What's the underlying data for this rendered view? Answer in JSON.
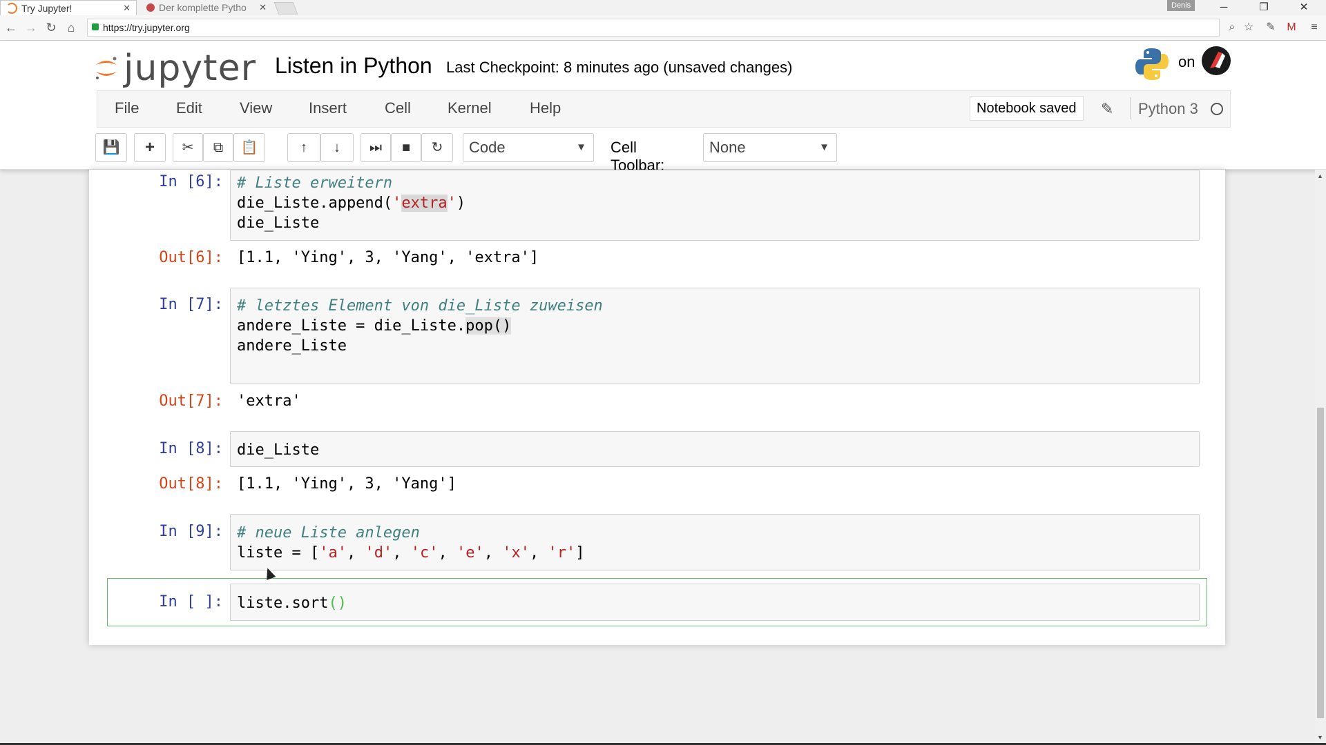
{
  "browser": {
    "tabs": [
      {
        "title": "Try Jupyter!",
        "active": true
      },
      {
        "title": "Der komplette Pytho",
        "active": false
      }
    ],
    "profile": "Denis",
    "url": "https://try.jupyter.org",
    "window_controls": [
      "minimize",
      "restore",
      "close"
    ]
  },
  "header": {
    "logo_text": "jupyter",
    "notebook_title": "Listen in Python",
    "checkpoint": "Last Checkpoint: 8 minutes ago (unsaved changes)",
    "on_text": "on"
  },
  "menu": {
    "items": [
      "File",
      "Edit",
      "View",
      "Insert",
      "Cell",
      "Kernel",
      "Help"
    ],
    "status": "Notebook saved",
    "kernel": "Python 3"
  },
  "toolbar": {
    "cell_type": "Code",
    "cell_toolbar_label": "Cell Toolbar:",
    "cell_toolbar_value": "None"
  },
  "cells": [
    {
      "in_prompt": "In [6]:",
      "code": {
        "l1_comment": "# Liste erweitern",
        "l2_pre": "die_Liste.append(",
        "l2_str_q1": "'",
        "l2_str_body": "extra",
        "l2_str_q2": "'",
        "l2_post": ")",
        "l3": "die_Liste"
      },
      "out_prompt": "Out[6]:",
      "output": "[1.1, 'Ying', 3, 'Yang', 'extra']"
    },
    {
      "in_prompt": "In [7]:",
      "code": {
        "l1_comment": "# letztes Element von die_Liste zuweisen",
        "l2_pre": "andere_Liste = die_Liste.",
        "l2_hl": "pop()",
        "l3": "andere_Liste"
      },
      "out_prompt": "Out[7]:",
      "output": "'extra'"
    },
    {
      "in_prompt": "In [8]:",
      "code": {
        "l1": "die_Liste"
      },
      "out_prompt": "Out[8]:",
      "output": "[1.1, 'Ying', 3, 'Yang']"
    },
    {
      "in_prompt": "In [9]:",
      "code": {
        "l1_comment": "# neue Liste anlegen",
        "l2_pre": "liste = [",
        "l2_s1": "'a'",
        "l2_c1": ", ",
        "l2_s2": "'d'",
        "l2_c2": ", ",
        "l2_s3": "'c'",
        "l2_c3": ", ",
        "l2_s4": "'e'",
        "l2_c4": ", ",
        "l2_s5": "'x'",
        "l2_c5": ", ",
        "l2_s6": "'r'",
        "l2_post": "]"
      }
    },
    {
      "in_prompt": "In [ ]:",
      "code": {
        "l1_pre": "liste.sort",
        "l1_parens": "()"
      }
    }
  ],
  "colors": {
    "in_prompt": "#303f9f",
    "out_prompt": "#d84315",
    "comment": "#408080",
    "string": "#ba2121",
    "selected_border": "#66bb6a"
  }
}
